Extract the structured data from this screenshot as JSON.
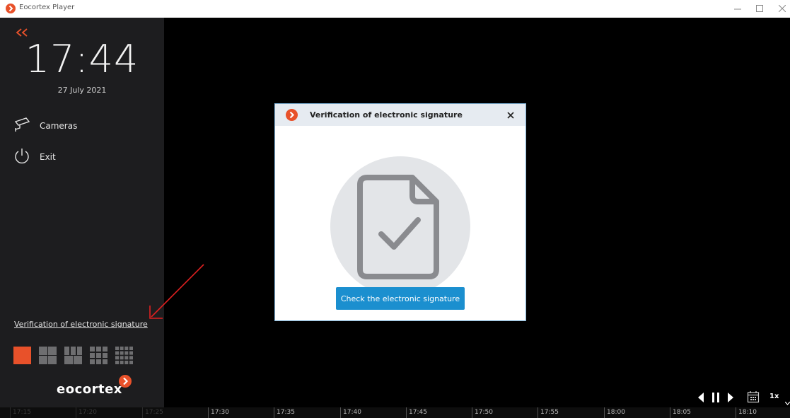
{
  "window": {
    "title": "Eocortex Player"
  },
  "sidebar": {
    "clock": "17:44",
    "date": "27 July 2021",
    "menu": [
      {
        "label": "Cameras",
        "icon": "camera-icon"
      },
      {
        "label": "Exit",
        "icon": "power-icon"
      }
    ],
    "verify_link": "Verification of electronic signature",
    "layouts": [
      "layout-1x1",
      "layout-2x2",
      "layout-3x3-split",
      "layout-3x3",
      "layout-4x4"
    ],
    "brand": "eocortex"
  },
  "dialog": {
    "title": "Verification of electronic signature",
    "button_label": "Check the electronic signature"
  },
  "controls": {
    "speed": "1x"
  },
  "timeline": {
    "ticks": [
      "17:15",
      "17:20",
      "17:25",
      "17:30",
      "17:35",
      "17:40",
      "17:45",
      "17:50",
      "17:55",
      "18:00",
      "18:05",
      "18:10"
    ],
    "dim_count": 3
  },
  "colors": {
    "accent": "#e8512a",
    "button": "#1b8fcf",
    "sidebar": "#1d1d1f",
    "annotation_arrow": "#e02020"
  }
}
